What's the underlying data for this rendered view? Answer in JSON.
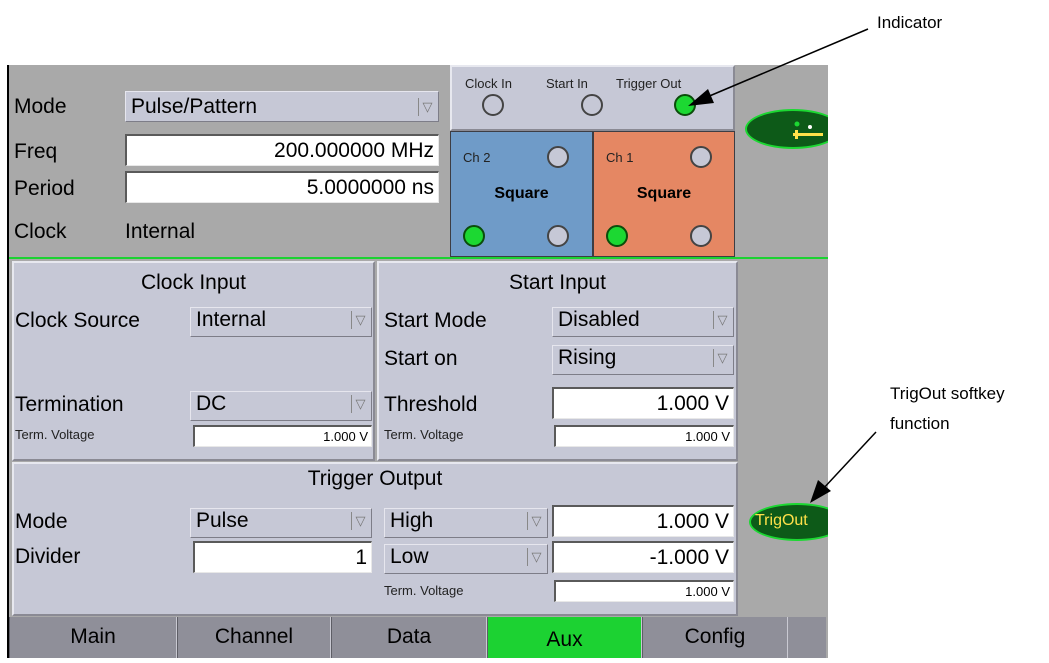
{
  "annotations": {
    "indicator": "Indicator",
    "trigout_line1": "TrigOut softkey",
    "trigout_line2": "function"
  },
  "main": {
    "mode_label": "Mode",
    "mode_value": "Pulse/Pattern",
    "freq_label": "Freq",
    "freq_value": "200.000000 MHz",
    "period_label": "Period",
    "period_value": "5.0000000 ns",
    "clock_label": "Clock",
    "clock_value": "Internal"
  },
  "indicators": {
    "clock_in": "Clock In",
    "start_in": "Start In",
    "trigger_out": "Trigger Out",
    "trigger_out_active": true
  },
  "channels": [
    {
      "name": "Ch 2",
      "waveform": "Square",
      "color": "#6f9bc8"
    },
    {
      "name": "Ch 1",
      "waveform": "Square",
      "color": "#e58763"
    }
  ],
  "clock_input": {
    "title": "Clock Input",
    "source_label": "Clock Source",
    "source_value": "Internal",
    "termination_label": "Termination",
    "termination_value": "DC",
    "term_voltage_label": "Term. Voltage",
    "term_voltage_value": "1.000 V"
  },
  "start_input": {
    "title": "Start Input",
    "mode_label": "Start Mode",
    "mode_value": "Disabled",
    "start_on_label": "Start on",
    "start_on_value": "Rising",
    "threshold_label": "Threshold",
    "threshold_value": "1.000 V",
    "term_voltage_label": "Term. Voltage",
    "term_voltage_value": "1.000 V"
  },
  "trigger_output": {
    "title": "Trigger Output",
    "mode_label": "Mode",
    "mode_value": "Pulse",
    "divider_label": "Divider",
    "divider_value": "1",
    "high_label": "High",
    "high_value": "1.000 V",
    "low_label": "Low",
    "low_value": "-1.000 V",
    "term_voltage_label": "Term. Voltage",
    "term_voltage_value": "1.000 V"
  },
  "softkeys": {
    "trigout": "TrigOut"
  },
  "tabs": [
    {
      "label": "Main",
      "active": false
    },
    {
      "label": "Channel",
      "active": false
    },
    {
      "label": "Data",
      "active": false
    },
    {
      "label": "Aux",
      "active": true
    },
    {
      "label": "Config",
      "active": false
    }
  ],
  "colors": {
    "led_on": "#1cd832",
    "softkey_bg": "#0d5a18",
    "softkey_text": "#ffe14a"
  }
}
